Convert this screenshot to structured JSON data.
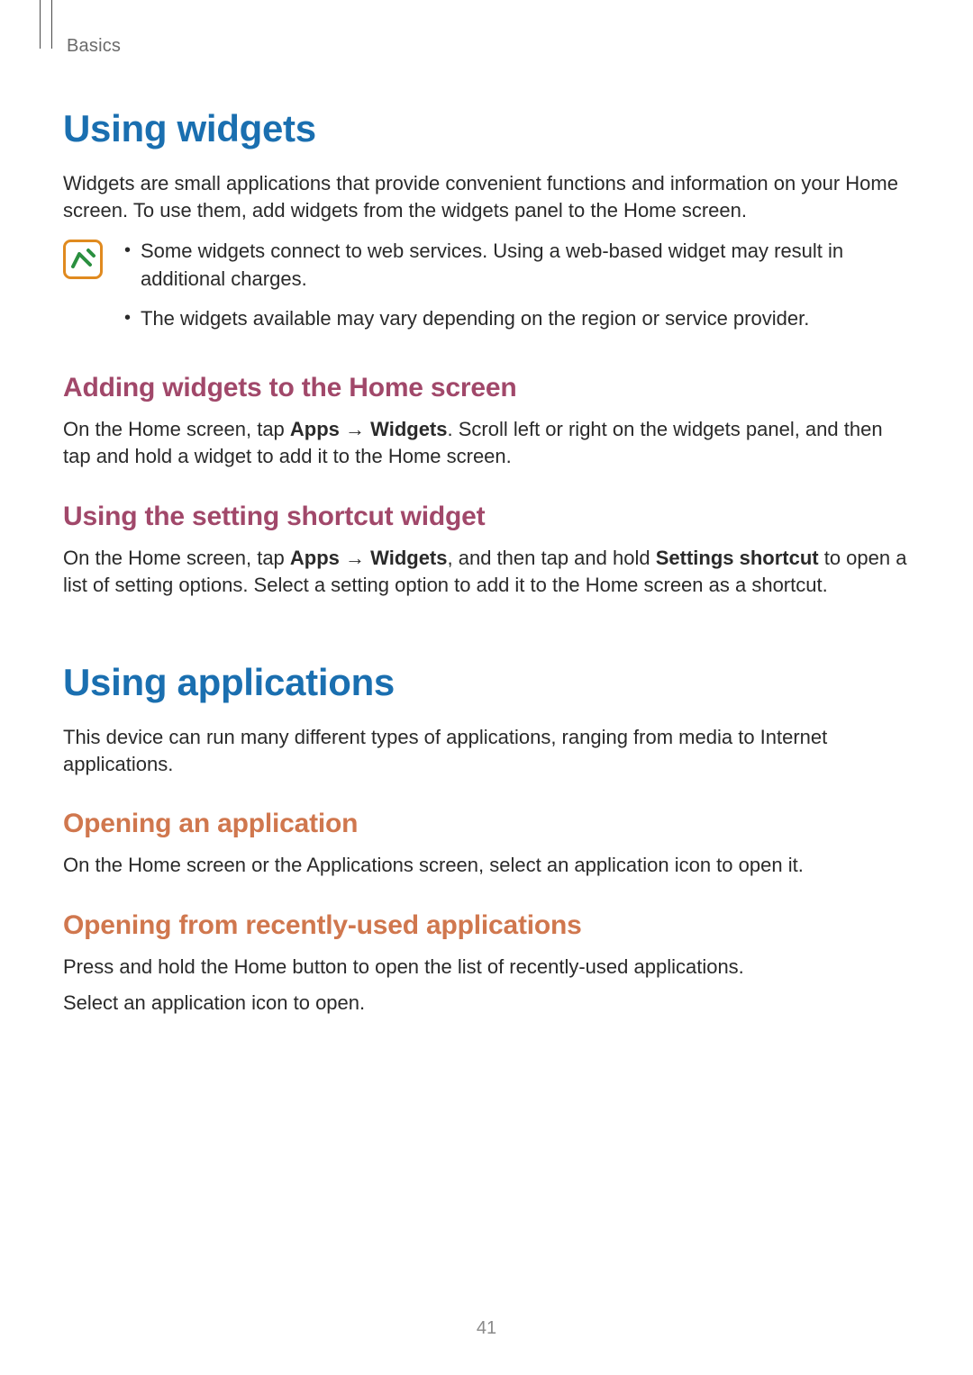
{
  "header": {
    "section": "Basics"
  },
  "s1": {
    "title": "Using widgets",
    "intro": "Widgets are small applications that provide convenient functions and information on your Home screen. To use them, add widgets from the widgets panel to the Home screen.",
    "notes": [
      "Some widgets connect to web services. Using a web-based widget may result in additional charges.",
      "The widgets available may vary depending on the region or service provider."
    ],
    "sub1": {
      "title": "Adding widgets to the Home screen",
      "p_a": "On the Home screen, tap ",
      "p_b": "Apps",
      "p_c": " → ",
      "p_d": "Widgets",
      "p_e": ". Scroll left or right on the widgets panel, and then tap and hold a widget to add it to the Home screen."
    },
    "sub2": {
      "title": "Using the setting shortcut widget",
      "p_a": "On the Home screen, tap ",
      "p_b": "Apps",
      "p_c": " → ",
      "p_d": "Widgets",
      "p_e": ", and then tap and hold ",
      "p_f": "Settings shortcut",
      "p_g": " to open a list of setting options. Select a setting option to add it to the Home screen as a shortcut."
    }
  },
  "s2": {
    "title": "Using applications",
    "intro": "This device can run many different types of applications, ranging from media to Internet applications.",
    "sub1": {
      "title": "Opening an application",
      "p": "On the Home screen or the Applications screen, select an application icon to open it."
    },
    "sub2": {
      "title": "Opening from recently-used applications",
      "p1": "Press and hold the Home button to open the list of recently-used applications.",
      "p2": "Select an application icon to open."
    }
  },
  "page_number": "41"
}
